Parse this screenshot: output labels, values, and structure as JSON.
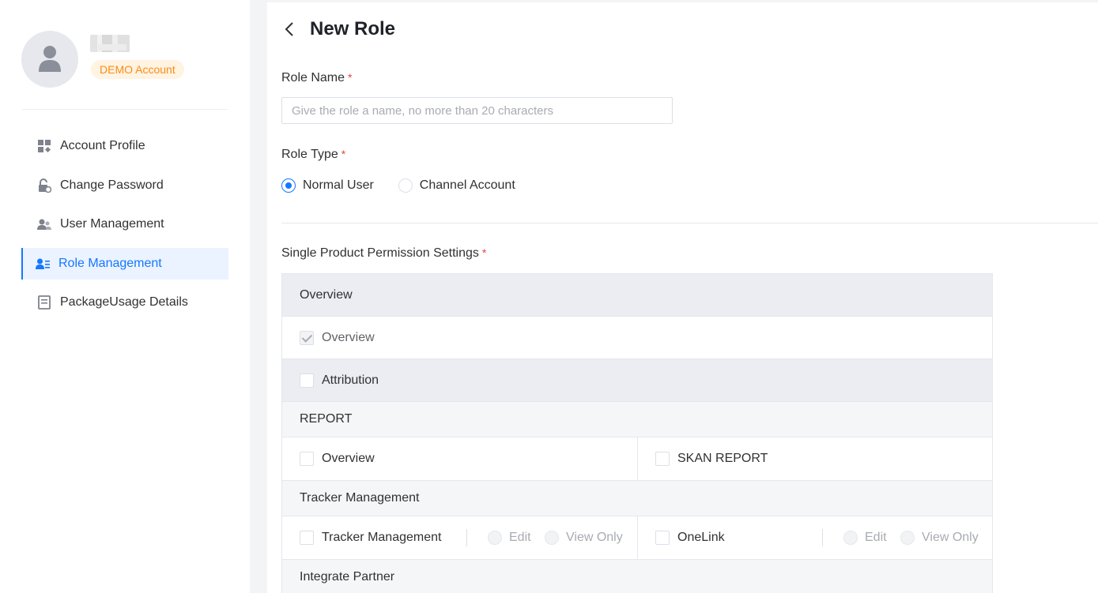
{
  "user": {
    "badge": "DEMO Account"
  },
  "sidebar": {
    "items": [
      {
        "label": "Account Profile",
        "icon": "grid-icon",
        "active": false
      },
      {
        "label": "Change Password",
        "icon": "lock-icon",
        "active": false
      },
      {
        "label": "User Management",
        "icon": "users-icon",
        "active": false
      },
      {
        "label": "Role Management",
        "icon": "role-list-icon",
        "active": true
      },
      {
        "label": "PackageUsage Details",
        "icon": "document-icon",
        "active": false
      }
    ]
  },
  "page": {
    "title": "New Role",
    "role_name_label": "Role Name",
    "role_name_placeholder": "Give the role a name, no more than 20 characters",
    "role_type_label": "Role Type",
    "role_type_options": [
      "Normal User",
      "Channel Account"
    ],
    "role_type_selected": "Normal User",
    "required_mark": "*",
    "permission_label": "Single Product Permission Settings"
  },
  "permissions": {
    "overview_group": "Overview",
    "overview_item": "Overview",
    "attribution_group": "Attribution",
    "report_section": "REPORT",
    "report_items": [
      "Overview",
      "SKAN REPORT"
    ],
    "tracker_section": "Tracker Management",
    "tracker_items": [
      "Tracker Management",
      "OneLink"
    ],
    "access_options": [
      "Edit",
      "View Only"
    ],
    "integrate_section": "Integrate Partner"
  },
  "colors": {
    "accent": "#1677ff",
    "badge_text": "#fa8c16",
    "badge_bg": "#fff3e2",
    "required": "#e54545"
  }
}
